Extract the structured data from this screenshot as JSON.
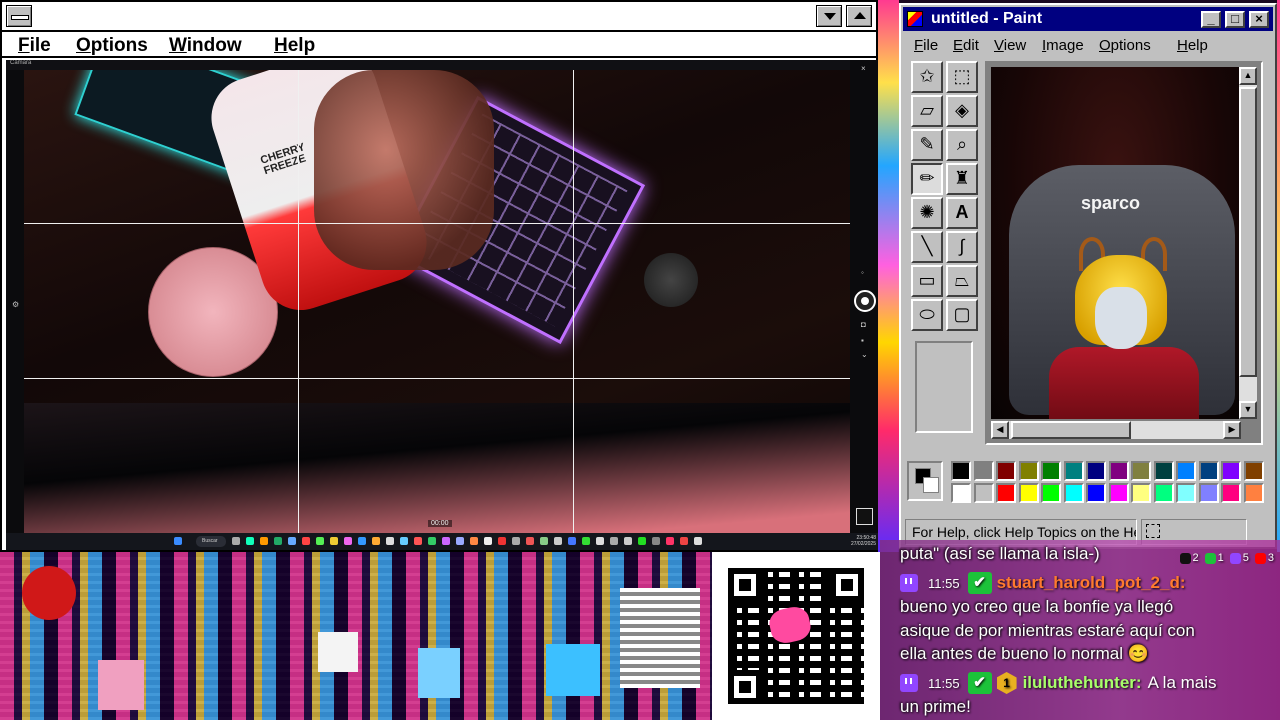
{
  "left_window": {
    "menu": [
      "File",
      "Options",
      "Window",
      "Help"
    ],
    "camera": {
      "app_label": "Cámara",
      "bottle_text": "CHERRY FREEZE",
      "timer": "00:00"
    },
    "taskbar": {
      "search_label": "Buscar",
      "clock_time": "23:50:48",
      "clock_date": "27/02/2025"
    }
  },
  "paint": {
    "title": "untitled - Paint",
    "menu": [
      "File",
      "Edit",
      "View",
      "Image",
      "Options",
      "Help"
    ],
    "canvas_brand": "sparco",
    "status_text": "For Help, click Help Topics on the Help Menu.",
    "palette_top": [
      "#000000",
      "#808080",
      "#800000",
      "#808000",
      "#008000",
      "#008080",
      "#000080",
      "#800080",
      "#808040",
      "#004040",
      "#0080ff",
      "#004080",
      "#8000ff",
      "#804000"
    ],
    "palette_bottom": [
      "#ffffff",
      "#c0c0c0",
      "#ff0000",
      "#ffff00",
      "#00ff00",
      "#00ffff",
      "#0000ff",
      "#ff00ff",
      "#ffff80",
      "#00ff80",
      "#80ffff",
      "#8080ff",
      "#ff0080",
      "#ff8040"
    ]
  },
  "chat": {
    "counts": [
      {
        "icon": "tiktok-icon",
        "value": "2",
        "color": "#111111"
      },
      {
        "icon": "xbox-icon",
        "value": "1",
        "color": "#1cc23a"
      },
      {
        "icon": "twitch-icon",
        "value": "5",
        "color": "#9146ff"
      },
      {
        "icon": "youtube-icon",
        "value": "3",
        "color": "#ff0000"
      }
    ],
    "partial_line": "puta\" (así se llama la isla-)",
    "messages": [
      {
        "time": "11:55",
        "username": "stuart_harold_pot_2_d:",
        "username_color": "#ff7a2e",
        "lines": [
          "bueno yo creo que la bonfie ya llegó",
          "asique de por mientras estaré aquí con",
          "ella antes de bueno lo normal 😊"
        ]
      },
      {
        "time": "11:55",
        "sub_badge": "1",
        "username": "iluluthehunter:",
        "username_color": "#a8ff6a",
        "first_text": "A la mais",
        "lines": [
          "un prime!"
        ]
      }
    ]
  }
}
